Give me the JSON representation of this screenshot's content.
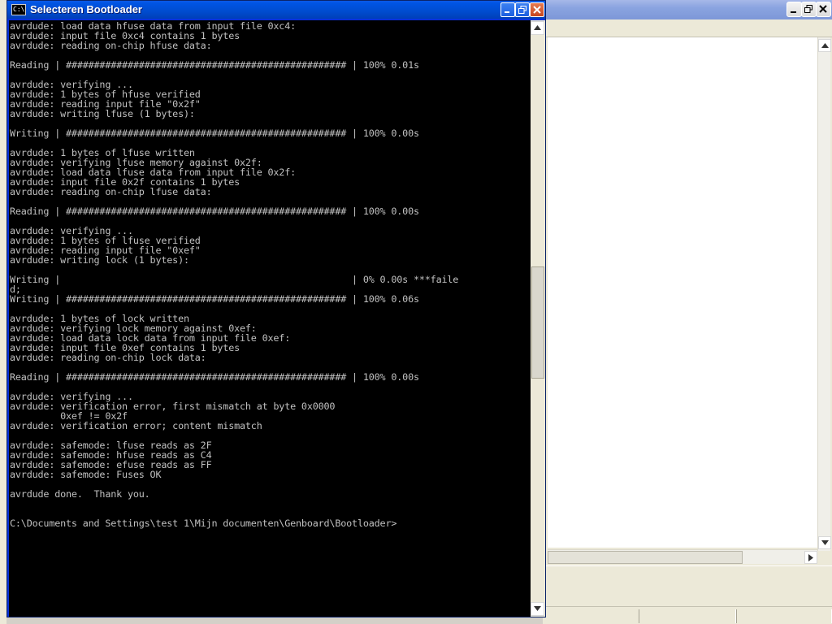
{
  "console": {
    "title": "Selecteren Bootloader",
    "icon_text": "C:\\",
    "icon": "cmd-icon",
    "lines": [
      "avrdude: load data hfuse data from input file 0xc4:",
      "avrdude: input file 0xc4 contains 1 bytes",
      "avrdude: reading on-chip hfuse data:",
      "",
      "Reading | ################################################## | 100% 0.01s",
      "",
      "avrdude: verifying ...",
      "avrdude: 1 bytes of hfuse verified",
      "avrdude: reading input file \"0x2f\"",
      "avrdude: writing lfuse (1 bytes):",
      "",
      "Writing | ################################################## | 100% 0.00s",
      "",
      "avrdude: 1 bytes of lfuse written",
      "avrdude: verifying lfuse memory against 0x2f:",
      "avrdude: load data lfuse data from input file 0x2f:",
      "avrdude: input file 0x2f contains 1 bytes",
      "avrdude: reading on-chip lfuse data:",
      "",
      "Reading | ################################################## | 100% 0.00s",
      "",
      "avrdude: verifying ...",
      "avrdude: 1 bytes of lfuse verified",
      "avrdude: reading input file \"0xef\"",
      "avrdude: writing lock (1 bytes):",
      "",
      "Writing |                                                    | 0% 0.00s ***faile",
      "d;",
      "Writing | ################################################## | 100% 0.06s",
      "",
      "avrdude: 1 bytes of lock written",
      "avrdude: verifying lock memory against 0xef:",
      "avrdude: load data lock data from input file 0xef:",
      "avrdude: input file 0xef contains 1 bytes",
      "avrdude: reading on-chip lock data:",
      "",
      "Reading | ################################################## | 100% 0.00s",
      "",
      "avrdude: verifying ...",
      "avrdude: verification error, first mismatch at byte 0x0000",
      "         0xef != 0x2f",
      "avrdude: verification error; content mismatch",
      "",
      "avrdude: safemode: lfuse reads as 2F",
      "avrdude: safemode: hfuse reads as C4",
      "avrdude: safemode: efuse reads as FF",
      "avrdude: safemode: Fuses OK",
      "",
      "avrdude done.  Thank you.",
      "",
      "",
      "C:\\Documents and Settings\\test 1\\Mijn documenten\\Genboard\\Bootloader>"
    ]
  },
  "colors": {
    "console_bg": "#000000",
    "console_text": "#c0c0c0",
    "titlebar_active": "#0054e3",
    "titlebar_inactive": "#8aa4e0",
    "window_face": "#ece9d8"
  }
}
